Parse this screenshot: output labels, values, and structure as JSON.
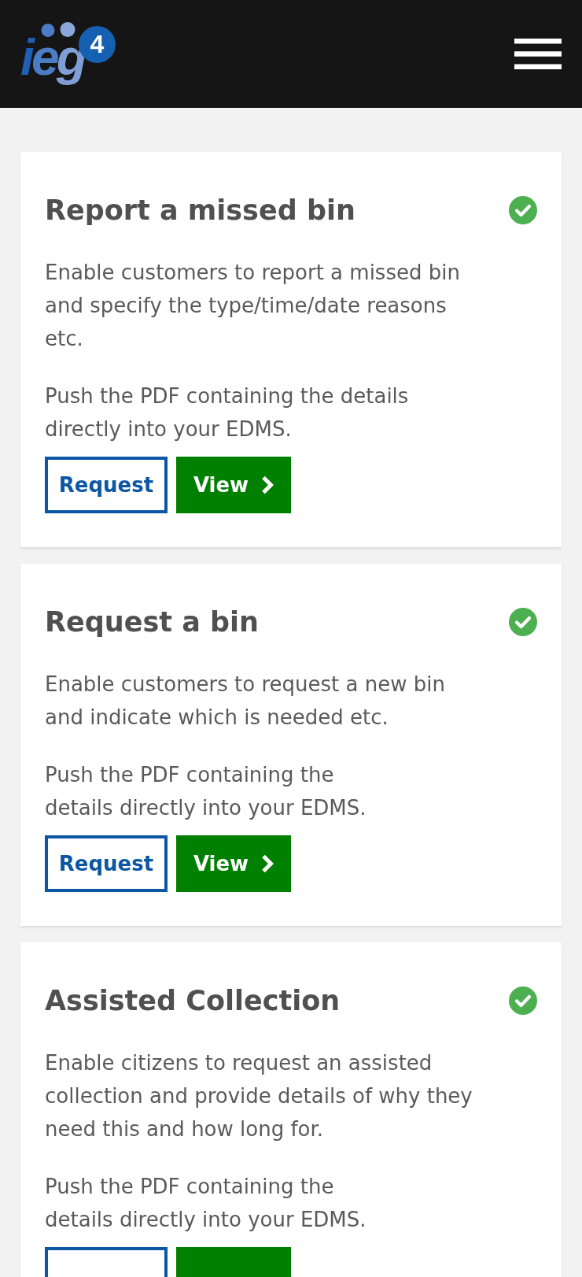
{
  "header": {
    "logo": {
      "wordmark": "ieg",
      "badge": "4"
    }
  },
  "cards": [
    {
      "title": "Report a missed bin",
      "available": true,
      "paragraphs": [
        "Enable customers to report a missed bin\nand specify the type/time/date reasons\netc.",
        "Push the PDF containing the details\ndirectly into your EDMS."
      ],
      "buttons": [
        {
          "kind": "outline",
          "label": "Request"
        },
        {
          "kind": "solid",
          "label": "View"
        }
      ]
    },
    {
      "title": "Request a bin",
      "available": true,
      "paragraphs": [
        "Enable customers to request a new bin\nand indicate which is needed etc.",
        "Push the PDF containing the\ndetails directly into your EDMS."
      ],
      "buttons": [
        {
          "kind": "outline",
          "label": "Request"
        },
        {
          "kind": "solid",
          "label": "View"
        }
      ]
    },
    {
      "title": "Assisted Collection",
      "available": true,
      "paragraphs": [
        "Enable citizens to request an assisted\ncollection and provide details of why they\nneed this and how long for.",
        "Push the PDF containing the\ndetails directly into your EDMS."
      ],
      "buttons": [
        {
          "kind": "outline"
        },
        {
          "kind": "solid"
        }
      ]
    }
  ]
}
